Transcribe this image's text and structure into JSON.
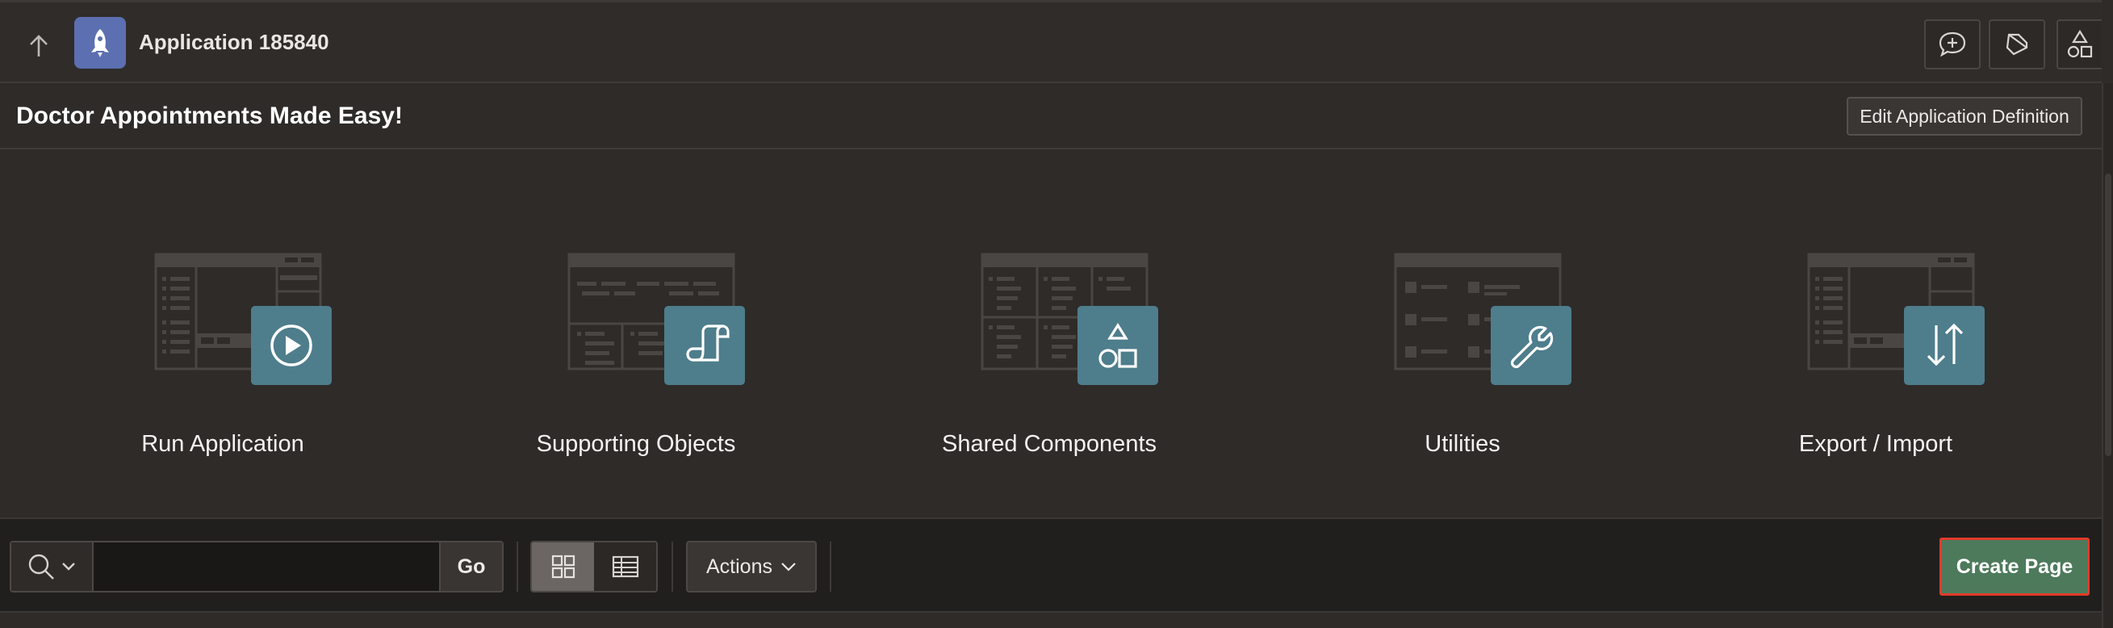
{
  "header": {
    "app_title": "Application 185840",
    "up_icon": "arrow-up-icon",
    "app_icon": "rocket-icon",
    "tools": [
      {
        "name": "feedback-button",
        "icon": "chat-plus-icon"
      },
      {
        "name": "developer-tools-button",
        "icon": "flashlight-icon"
      },
      {
        "name": "shared-components-shortcut",
        "icon": "shapes-icon"
      }
    ]
  },
  "subhead": {
    "title": "Doctor Appointments Made Easy!",
    "edit_button": "Edit Application Definition"
  },
  "tiles": [
    {
      "label": "Run Application",
      "icon": "play-icon"
    },
    {
      "label": "Supporting Objects",
      "icon": "scroll-icon"
    },
    {
      "label": "Shared Components",
      "icon": "shapes-icon"
    },
    {
      "label": "Utilities",
      "icon": "wrench-icon"
    },
    {
      "label": "Export / Import",
      "icon": "arrows-up-down-icon"
    }
  ],
  "toolbar": {
    "search_value": "",
    "go_label": "Go",
    "actions_label": "Actions",
    "create_page_label": "Create Page",
    "view_modes": [
      "icons",
      "report"
    ],
    "active_view": "icons"
  },
  "colors": {
    "background": "#2e2b29",
    "tile_icon": "#4e7d8c",
    "create_button": "#4d7a5b",
    "highlight_border": "#e23b2a",
    "app_icon": "#5c6fb0"
  }
}
